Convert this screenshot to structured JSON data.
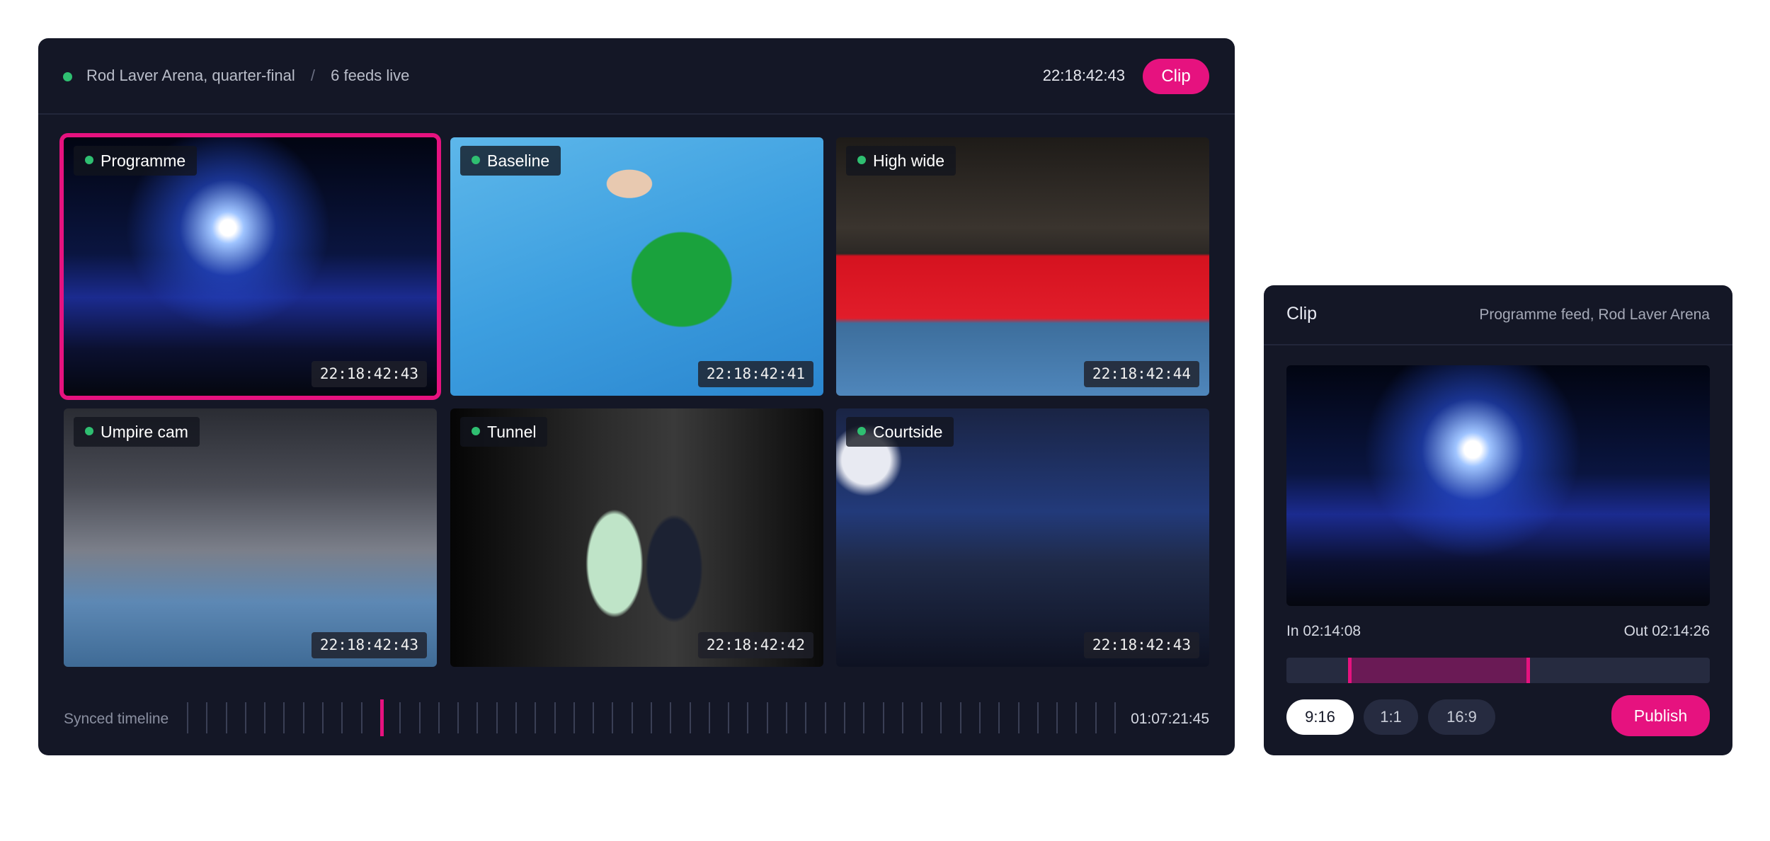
{
  "header": {
    "venue": "Rod Laver Arena, quarter-final",
    "separator": "/",
    "feeds_status": "6 feeds live",
    "timecode": "22:18:42:43",
    "clip_label": "Clip"
  },
  "feeds": [
    {
      "name": "Programme",
      "timecode": "22:18:42:43",
      "active": true
    },
    {
      "name": "Baseline",
      "timecode": "22:18:42:41",
      "active": false
    },
    {
      "name": "High wide",
      "timecode": "22:18:42:44",
      "active": false
    },
    {
      "name": "Umpire cam",
      "timecode": "22:18:42:43",
      "active": false
    },
    {
      "name": "Tunnel",
      "timecode": "22:18:42:42",
      "active": false
    },
    {
      "name": "Courtside",
      "timecode": "22:18:42:43",
      "active": false
    }
  ],
  "timeline": {
    "label": "Synced timeline",
    "duration": "01:07:21:45",
    "tick_count": 49,
    "playhead_tick": 10
  },
  "clip_panel": {
    "title": "Clip",
    "source": "Programme feed, Rod Laver Arena",
    "in_point": "In 02:14:08",
    "out_point": "Out 02:14:26",
    "trim_start": 0.145,
    "trim_end": 0.575,
    "aspect_ratios": [
      "9:16",
      "1:1",
      "16:9"
    ],
    "selected_aspect": "9:16",
    "publish_label": "Publish"
  },
  "colors": {
    "panel_bg": "#141726",
    "accent": "#e6127f",
    "live_dot": "#2fbf71"
  }
}
